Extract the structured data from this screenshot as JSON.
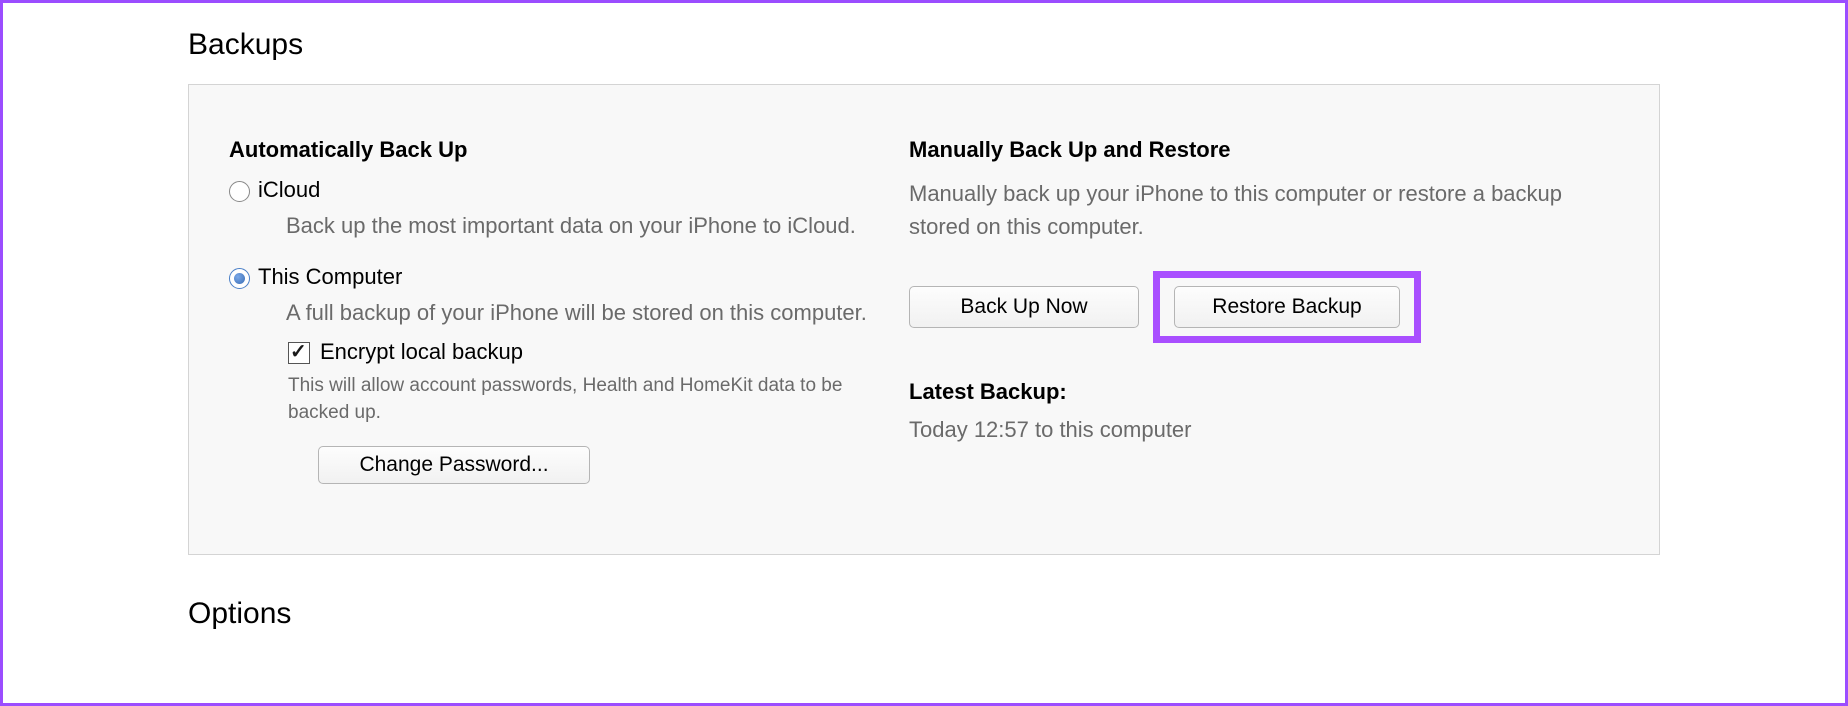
{
  "section_title": "Backups",
  "options_title": "Options",
  "auto": {
    "heading": "Automatically Back Up",
    "icloud": {
      "label": "iCloud",
      "desc": "Back up the most important data on your iPhone to iCloud.",
      "selected": false
    },
    "computer": {
      "label": "This Computer",
      "desc": "A full backup of your iPhone will be stored on this computer.",
      "selected": true
    },
    "encrypt": {
      "label": "Encrypt local backup",
      "desc": "This will allow account passwords, Health and HomeKit data to be backed up.",
      "checked": true
    },
    "change_password_label": "Change Password..."
  },
  "manual": {
    "heading": "Manually Back Up and Restore",
    "desc": "Manually back up your iPhone to this computer or restore a backup stored on this computer.",
    "backup_now_label": "Back Up Now",
    "restore_label": "Restore Backup"
  },
  "latest": {
    "heading": "Latest Backup:",
    "value": "Today 12:57 to this computer"
  }
}
